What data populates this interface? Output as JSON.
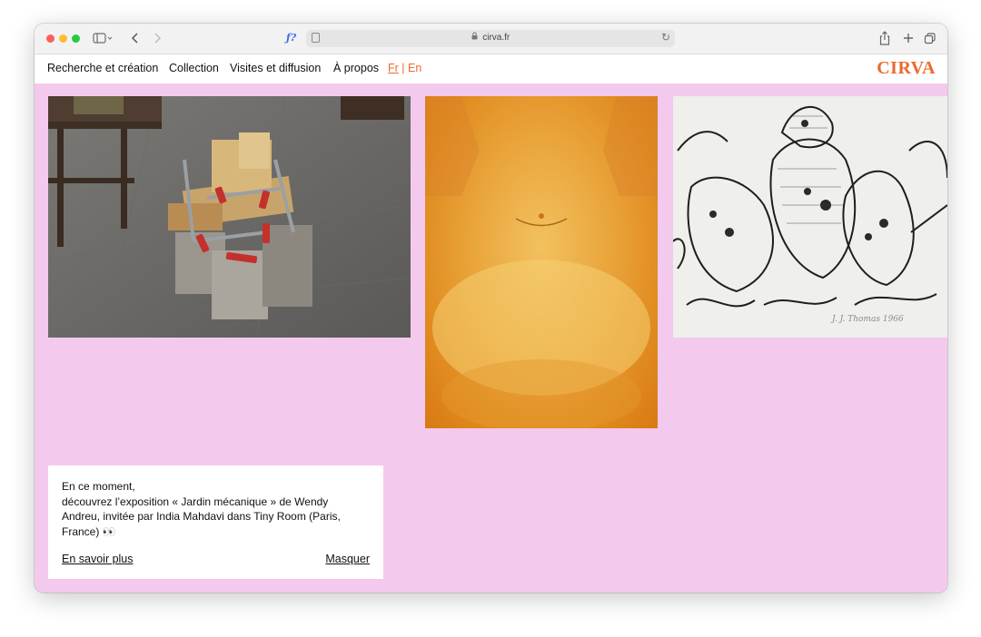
{
  "browser": {
    "url": "cirva.fr",
    "icons": [
      "sidebar-icon",
      "back-icon",
      "forward-icon",
      "reader-icon",
      "lock-icon",
      "reload-icon",
      "share-icon",
      "new-tab-icon",
      "tabs-icon"
    ],
    "extension_label": "ƒ?"
  },
  "nav": {
    "items": [
      "Recherche et création",
      "Collection",
      "Visites et diffusion",
      "À propos"
    ],
    "lang_fr": "Fr",
    "lang_sep": "|",
    "lang_en": "En",
    "logo": "CIRVA"
  },
  "colors": {
    "accent": "#ec6a2c",
    "background": "#f4c9ee"
  },
  "notice": {
    "line1": "En ce moment,",
    "line2": "découvrez l’exposition « Jardin mécanique » de Wendy",
    "line3": "Andreu, invitée par India Mahdavi dans Tiny Room (Paris,",
    "line4": "France) 👀",
    "more_label": "En savoir plus",
    "hide_label": "Masquer"
  },
  "drawing_signature": "J. J. Thomas 1966"
}
